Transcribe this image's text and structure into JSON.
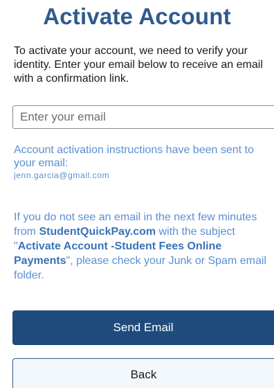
{
  "page": {
    "title": "Activate Account",
    "intro": "To activate your account, we need to verify your identity. Enter your email below to receive an email with a confirmation link."
  },
  "email_field": {
    "placeholder": "Enter your email",
    "value": ""
  },
  "notice": {
    "sent_message": "Account activation instructions have been sent to your email:",
    "email": "jenn.garcia@gmail.com"
  },
  "help": {
    "part1": "If you do not see an email in the next few minutes from ",
    "site": "StudentQuickPay.com",
    "part2": " with the subject \"",
    "subject": "Activate Account -Student Fees Online Payments",
    "part3": "\", please check your Junk or Spam email folder."
  },
  "buttons": {
    "send_label": "Send Email",
    "back_label": "Back"
  },
  "colors": {
    "title": "#2e5b8c",
    "notice_text": "#5a8fd1",
    "primary_button": "#1f4b7c",
    "secondary_button_bg": "#f3f8fd"
  }
}
